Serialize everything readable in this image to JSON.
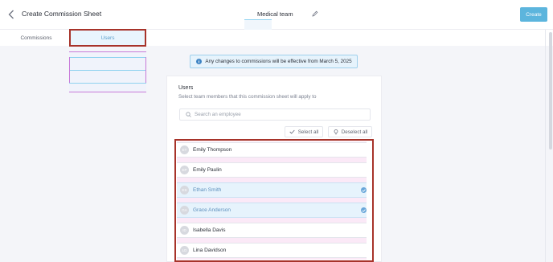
{
  "header": {
    "title": "Create Commission Sheet",
    "team_name": "Medical team",
    "create_label": "Create",
    "back_icon": "chevron-left-icon",
    "edit_icon": "pencil-icon"
  },
  "tabs": [
    {
      "label": "Commissions",
      "active": false
    },
    {
      "label": "Users",
      "active": true
    }
  ],
  "notice": {
    "text": "Any changes to commissions will be effective from March 5, 2025",
    "icon": "info-icon"
  },
  "users_panel": {
    "title": "Users",
    "subtitle": "Select team members that this commission sheet will apply to",
    "search_placeholder": "Search an employee",
    "select_all_label": "Select all",
    "deselect_all_label": "Deselect all"
  },
  "users": [
    {
      "initials": "ET",
      "name": "Emily Thompson",
      "selected": false
    },
    {
      "initials": "EP",
      "name": "Emily Paulin",
      "selected": false
    },
    {
      "initials": "ES",
      "name": "Ethan Smith",
      "selected": true
    },
    {
      "initials": "GA",
      "name": "Grace Anderson",
      "selected": true
    },
    {
      "initials": "ID",
      "name": "Isabella Davis",
      "selected": false
    },
    {
      "initials": "LD",
      "name": "Lina Davidson",
      "selected": false
    }
  ],
  "colors": {
    "accent": "#5cb5dd",
    "selected_row": "#e6f3fc",
    "highlight_outline": "#a7332a"
  }
}
